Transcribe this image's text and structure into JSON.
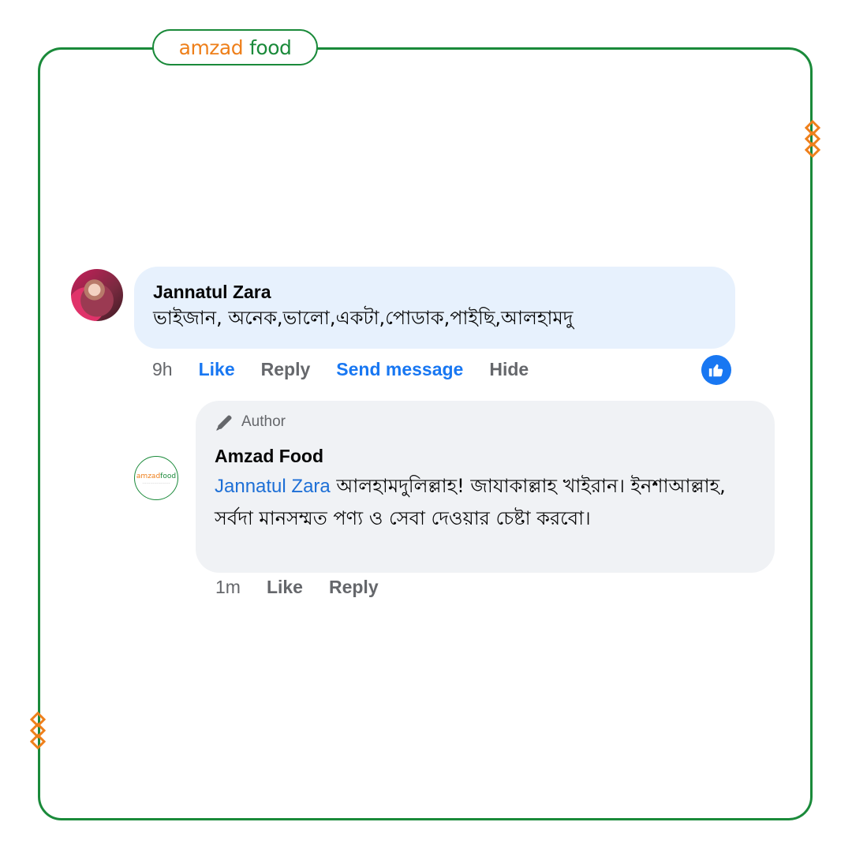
{
  "brand": {
    "word1": "amzad",
    "word2": "food",
    "primary_color": "#1a8a3a",
    "accent_color": "#ee7f1a"
  },
  "comment": {
    "author": "Jannatul Zara",
    "text": "ভাইজান, অনেক,ভালো,একটা,পোডাক,পাইছি,আলহামদু",
    "actions": {
      "time": "9h",
      "like": "Like",
      "reply": "Reply",
      "send_message": "Send message",
      "hide": "Hide"
    },
    "reaction_icon": "thumbs-up-icon"
  },
  "reply": {
    "badge": "Author",
    "author": "Amzad Food",
    "mention": "Jannatul Zara",
    "text": " আলহামদুলিল্লাহ! জাযাকাল্লাহ খাইরান। ইনশাআল্লাহ, সর্বদা মানসম্মত পণ্য ও সেবা দেওয়ার চেষ্টা করবো।",
    "actions": {
      "time": "1m",
      "like": "Like",
      "reply": "Reply"
    }
  }
}
